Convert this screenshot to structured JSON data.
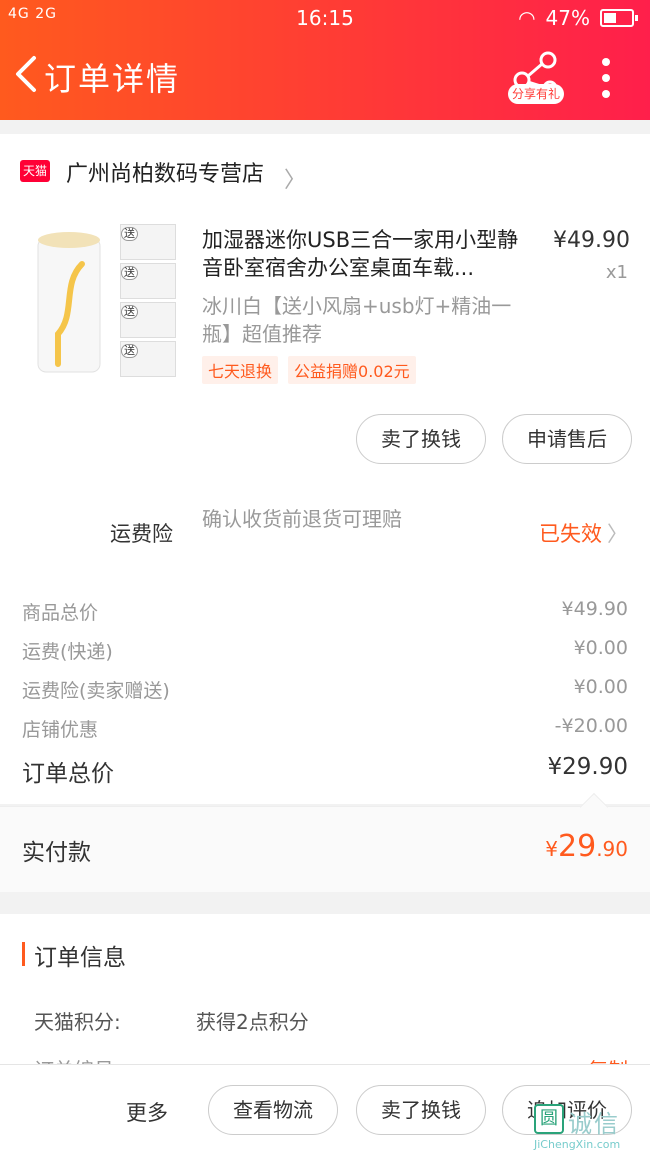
{
  "status_bar": {
    "signal": "4G  2G",
    "time": "16:15",
    "battery": "47%"
  },
  "header": {
    "title": "订单详情",
    "share_label": "分享有礼"
  },
  "store": {
    "badge": "天猫",
    "name": "广州尚柏数码专营店"
  },
  "product": {
    "title": "加湿器迷你USB三合一家用小型静音卧室宿舍办公室桌面车载...",
    "spec": "冰川白【送小风扇+usb灯+精油一瓶】超值推荐",
    "price": "¥49.90",
    "qty": "x1",
    "thumb_tags": [
      "送",
      "送",
      "送",
      "送"
    ],
    "tags": [
      "七天退换",
      "公益捐赠0.02元"
    ],
    "actions": [
      "卖了换钱",
      "申请售后"
    ]
  },
  "freight_insurance": {
    "label": "运费险",
    "desc": "确认收货前退货可理赔",
    "status": "已失效"
  },
  "summary": {
    "rows": [
      {
        "label": "商品总价",
        "value": "¥49.90"
      },
      {
        "label": "运费(快递)",
        "value": "¥0.00"
      },
      {
        "label": "运费险(卖家赠送)",
        "value": "¥0.00"
      },
      {
        "label": "店铺优惠",
        "value": "-¥20.00"
      }
    ],
    "total_label": "订单总价",
    "total_value": "¥29.90"
  },
  "paid": {
    "label": "实付款",
    "currency": "¥",
    "integer": "29",
    "decimal": ".90"
  },
  "order_info": {
    "title": "订单信息",
    "points_label": "天猫积分:",
    "points_value": "获得2点积分",
    "order_no_label": "订单编号",
    "order_no_value": "",
    "copy_label": "复制"
  },
  "bottom_bar": {
    "more": "更多",
    "buttons": [
      "查看物流",
      "卖了换钱",
      "追加评价"
    ]
  },
  "watermark": {
    "badge": "圆",
    "text": "诚信",
    "url": "JiChengXin.com"
  },
  "colors": {
    "accent": "#ff5a1e",
    "header_start": "#ff5a1e",
    "header_end": "#ff1f4b"
  }
}
